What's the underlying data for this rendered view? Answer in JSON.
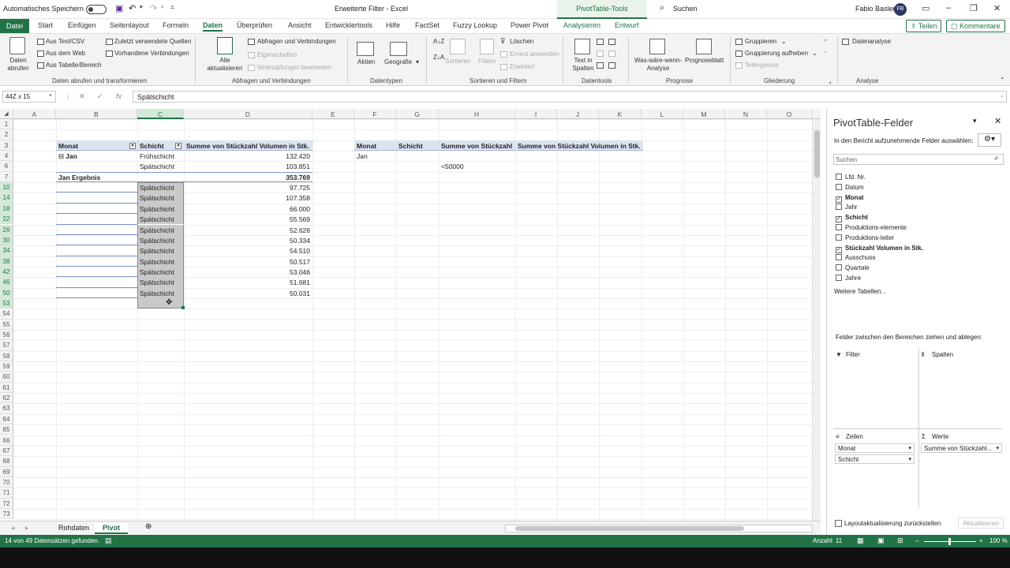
{
  "titlebar": {
    "autosave": "Automatisches Speichern",
    "doc_title": "Erweiterte Filter - Excel",
    "contextual": "PivotTable-Tools",
    "search": "Suchen",
    "user": "Fabio Basler",
    "initials": "FB"
  },
  "tabs": [
    "Datei",
    "Start",
    "Einfügen",
    "Seitenlayout",
    "Formeln",
    "Daten",
    "Überprüfen",
    "Ansicht",
    "Entwicklertools",
    "Hilfe",
    "FactSet",
    "Fuzzy Lookup",
    "Power Pivot",
    "Analysieren",
    "Entwurf"
  ],
  "active_tab": "Daten",
  "share": "Teilen",
  "comments": "Kommentare",
  "ribbon": {
    "data_get": "Daten abrufen",
    "from_text": "Aus Text/CSV",
    "from_web": "Aus dem Web",
    "from_table": "Aus Tabelle/Bereich",
    "recent": "Zuletzt verwendete Quellen",
    "existing": "Vorhandene Verbindungen",
    "g1": "Daten abrufen und transformieren",
    "refresh": "Alle aktualisieren",
    "queries": "Abfragen und Verbindungen",
    "properties": "Eigenschaften",
    "edit_links": "Verknüpfungen bearbeiten",
    "g2": "Abfragen und Verbindungen",
    "stocks": "Aktien",
    "geo": "Geografie",
    "g3": "Datentypen",
    "sort": "Sortieren",
    "filter": "Filtern",
    "clear": "Löschen",
    "reapply": "Erneut anwenden",
    "advanced": "Erweitert",
    "g4": "Sortieren und Filtern",
    "text_cols": "Text in Spalten",
    "g5": "Datentools",
    "whatif": "Was-wäre-wenn-Analyse",
    "forecast": "Prognoseblatt",
    "g6": "Prognose",
    "group": "Gruppieren",
    "ungroup": "Gruppierung aufheben",
    "subtotal": "Teilergebnis",
    "g7": "Gliederung",
    "analysis": "Datenanalyse",
    "g8": "Analyse"
  },
  "formula": {
    "namebox": "44Z x 15",
    "value": "Spätschicht"
  },
  "columns": [
    "A",
    "B",
    "C",
    "D",
    "E",
    "F",
    "G",
    "H",
    "I",
    "J",
    "K",
    "L",
    "M",
    "N",
    "O"
  ],
  "rows": [
    "1",
    "2",
    "3",
    "4",
    "6",
    "7",
    "10",
    "14",
    "18",
    "22",
    "26",
    "30",
    "34",
    "38",
    "42",
    "46",
    "50",
    "53",
    "54",
    "55",
    "56",
    "57",
    "58",
    "59",
    "60",
    "61",
    "62",
    "63",
    "64",
    "65",
    "66",
    "67",
    "68",
    "69",
    "70",
    "71",
    "72",
    "73"
  ],
  "pivot": {
    "h_month": "Monat",
    "h_shift": "Schicht",
    "h_sum": "Summe von Stückzahl Volumen in Stk.",
    "collapse": "⊟",
    "month": "Jan",
    "r4_shift": "Frühschicht",
    "r4_val": "132.420",
    "r6_shift": "Spätschicht",
    "r6_val": "103.851",
    "total_label": "Jan Ergebnis",
    "total_val": "353.769"
  },
  "selected_rows": [
    {
      "shift": "Spätschicht",
      "val": "97.725"
    },
    {
      "shift": "Spätschicht",
      "val": "107.358"
    },
    {
      "shift": "Spätschicht",
      "val": "66.000"
    },
    {
      "shift": "Spätschicht",
      "val": "55.569"
    },
    {
      "shift": "Spätschicht",
      "val": "52.626"
    },
    {
      "shift": "Spätschicht",
      "val": "50.334"
    },
    {
      "shift": "Spätschicht",
      "val": "54.510"
    },
    {
      "shift": "Spätschicht",
      "val": "50.517"
    },
    {
      "shift": "Spätschicht",
      "val": "53.046"
    },
    {
      "shift": "Spätschicht",
      "val": "51.681"
    },
    {
      "shift": "Spätschicht",
      "val": "50.031"
    }
  ],
  "criteria": {
    "h_month": "Monat",
    "h_shift": "Schicht",
    "h_sum": "Summe von Stückzahl",
    "h_sum2": "Summe von Stückzahl Volumen in Stk.",
    "month": "Jan",
    "cond": "<50000"
  },
  "sheets": [
    "Rohdaten",
    "Pivot"
  ],
  "active_sheet": "Pivot",
  "pane": {
    "title": "PivotTable-Felder",
    "subtitle": "In den Bericht aufzunehmende Felder auswählen:",
    "search": "Suchen",
    "fields": [
      {
        "label": "Lfd. Nr.",
        "checked": false
      },
      {
        "label": "Datum",
        "checked": false
      },
      {
        "label": "Monat",
        "checked": true
      },
      {
        "label": "Jahr",
        "checked": false
      },
      {
        "label": "Schicht",
        "checked": true
      },
      {
        "label": "Produktions-elemente",
        "checked": false
      },
      {
        "label": "Produktions-leiter",
        "checked": false
      },
      {
        "label": "Stückzahl Volumen in Stk.",
        "checked": true
      },
      {
        "label": "Ausschuss",
        "checked": false
      },
      {
        "label": "Quartale",
        "checked": false
      },
      {
        "label": "Jahre",
        "checked": false
      }
    ],
    "more_tables": "Weitere Tabellen...",
    "drag_hint": "Felder zwischen den Bereichen ziehen und ablegen:",
    "filter": "Filter",
    "columns": "Spalten",
    "rows": "Zeilen",
    "values": "Werte",
    "row_items": [
      "Monat",
      "Schicht"
    ],
    "value_items": [
      "Summe von Stückzahl..."
    ],
    "defer": "Layoutaktualisierung zurückstellen",
    "update": "Aktualisieren"
  },
  "status": {
    "left": "14 von 49 Datensätzen gefunden.",
    "count": "Anzahl: 11",
    "zoom": "100 %"
  }
}
